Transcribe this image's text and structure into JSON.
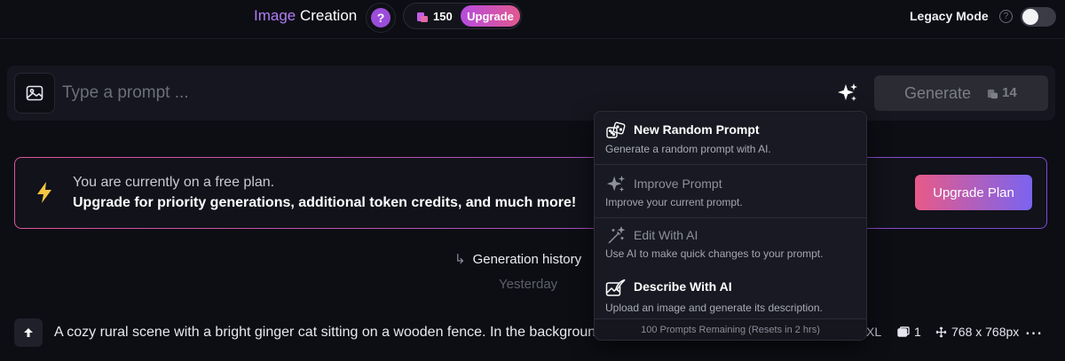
{
  "header": {
    "brand_part1": "Image",
    "brand_part2": "Creation",
    "help_glyph": "?",
    "credits": "150",
    "upgrade_label": "Upgrade",
    "legacy_label": "Legacy Mode",
    "legacy_info_glyph": "?",
    "legacy_toggle_on": false
  },
  "prompt": {
    "placeholder": "Type a prompt ...",
    "value": "",
    "generate_label": "Generate",
    "generate_cost": "14"
  },
  "banner": {
    "line1": "You are currently on a free plan.",
    "line2": "Upgrade for priority generations, additional token credits, and much more!",
    "button": "Upgrade Plan"
  },
  "history": {
    "title": "Generation history",
    "day": "Yesterday",
    "row": {
      "prompt": "A cozy rural scene with a bright ginger cat sitting on a wooden fence. In the background",
      "size_label": "XL",
      "count": "1",
      "resolution": "768 x 768px"
    }
  },
  "menu": {
    "items": [
      {
        "title": "New Random Prompt",
        "desc": "Generate a random prompt with AI.",
        "icon": "dice-icon"
      },
      {
        "title": "Improve Prompt",
        "desc": "Improve your current prompt.",
        "icon": "sparkle-icon"
      },
      {
        "title": "Edit With AI",
        "desc": "Use AI to make quick changes to your prompt.",
        "icon": "magic-wand-icon"
      },
      {
        "title": "Describe With AI",
        "desc": "Upload an image and generate its description.",
        "icon": "image-quill-icon"
      }
    ],
    "footer": "100 Prompts Remaining (Resets in 2 hrs)"
  },
  "colors": {
    "accent_purple": "#b07cf6",
    "upgrade_gradient_start": "#b64cde",
    "upgrade_gradient_end": "#e1588f",
    "bolt_yellow": "#f5c542"
  }
}
